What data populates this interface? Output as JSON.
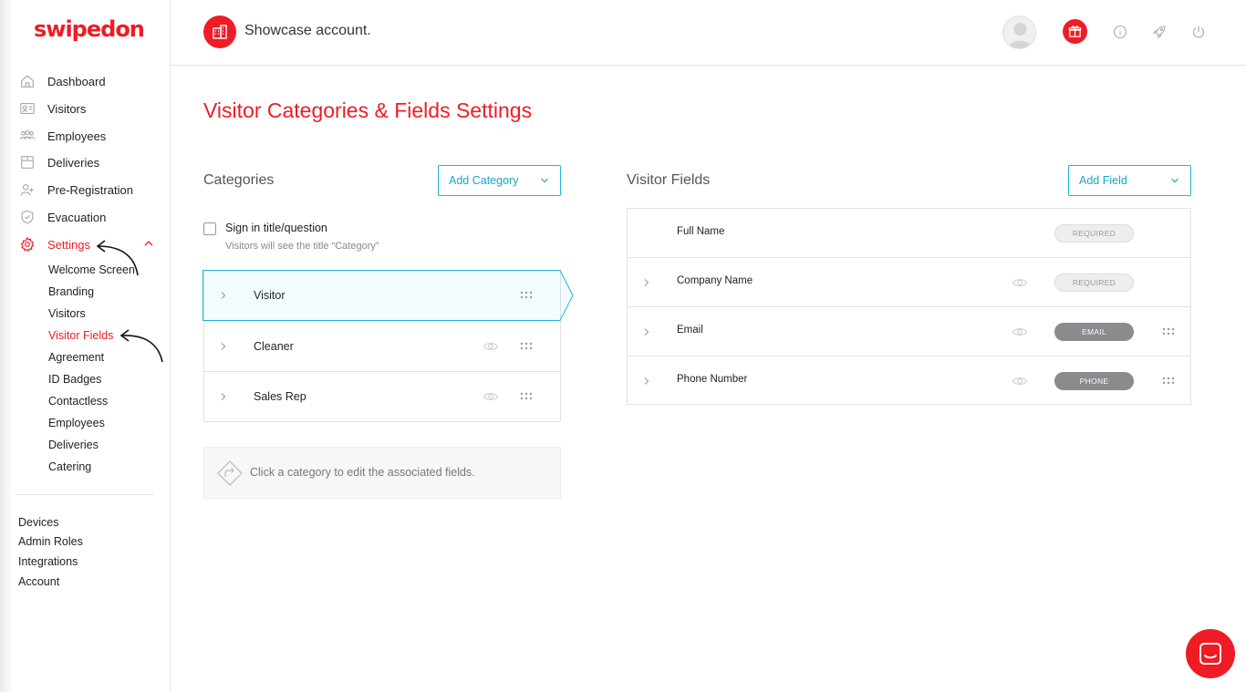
{
  "brand": {
    "name": "swipedon",
    "accent": "#ef1c25",
    "link": "#1aa6c6"
  },
  "sidebar": {
    "items": [
      {
        "label": "Dashboard",
        "icon": "home-icon"
      },
      {
        "label": "Visitors",
        "icon": "id-card-icon"
      },
      {
        "label": "Employees",
        "icon": "people-icon"
      },
      {
        "label": "Deliveries",
        "icon": "box-icon"
      },
      {
        "label": "Pre-Registration",
        "icon": "user-plus-icon"
      },
      {
        "label": "Evacuation",
        "icon": "shield-icon"
      },
      {
        "label": "Settings",
        "icon": "gear-icon"
      }
    ],
    "settings_sub": [
      "Welcome Screen",
      "Branding",
      "Visitors",
      "Visitor Fields",
      "Agreement",
      "ID Badges",
      "Contactless",
      "Employees",
      "Deliveries",
      "Catering"
    ],
    "bottom": [
      "Devices",
      "Admin Roles",
      "Integrations",
      "Account"
    ]
  },
  "header": {
    "account_name": "Showcase account."
  },
  "page": {
    "title": "Visitor Categories & Fields Settings"
  },
  "categories": {
    "title": "Categories",
    "add_button": "Add Category",
    "sign_in_label": "Sign in title/question",
    "sign_in_hint": "Visitors will see the title “Category”",
    "rows": [
      "Visitor",
      "Cleaner",
      "Sales Rep"
    ],
    "hint": "Click a category to edit the associated fields."
  },
  "fields": {
    "title": "Visitor Fields",
    "add_button": "Add Field",
    "rows": [
      {
        "name": "Full Name",
        "badge": "REQUIRED"
      },
      {
        "name": "Company Name",
        "badge": "REQUIRED"
      },
      {
        "name": "Email",
        "badge": "EMAIL"
      },
      {
        "name": "Phone Number",
        "badge": "PHONE"
      }
    ]
  }
}
